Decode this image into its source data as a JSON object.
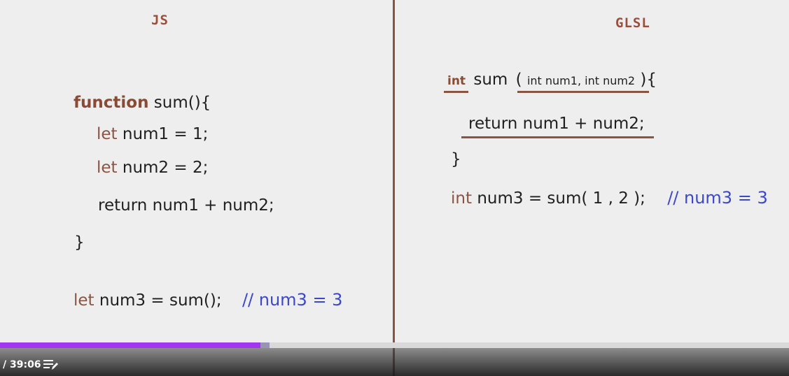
{
  "left": {
    "heading": "JS",
    "fn_keyword": "function",
    "fn_name": "sum(){",
    "let1_kw": "let",
    "let1_rest": "num1 = 1;",
    "let2_kw": "let",
    "let2_rest": "num2 = 2;",
    "return_line": "return num1 + num2;",
    "close_brace": "}",
    "call_kw": "let",
    "call_rest": "num3 = sum();",
    "comment": "// num3 = 3"
  },
  "right": {
    "heading": "GLSL",
    "ret_type": "int",
    "fn_name": "sum",
    "open_paren": "(",
    "params": "int num1, int num2",
    "close_paren": "){",
    "return_line": "return num1 + num2;",
    "close_brace": "}",
    "call_kw": "int",
    "call_rest": "num3 = sum( 1 , 2 );",
    "comment": "// num3 = 3"
  },
  "player": {
    "time_text": "/ 39:06",
    "progress_percent": 33,
    "buffered_percent": 34.2,
    "icon_notes": "notes-icon"
  },
  "colors": {
    "keyword": "#8a5443",
    "comment": "#3b48c8",
    "progress": "#a435f0"
  }
}
